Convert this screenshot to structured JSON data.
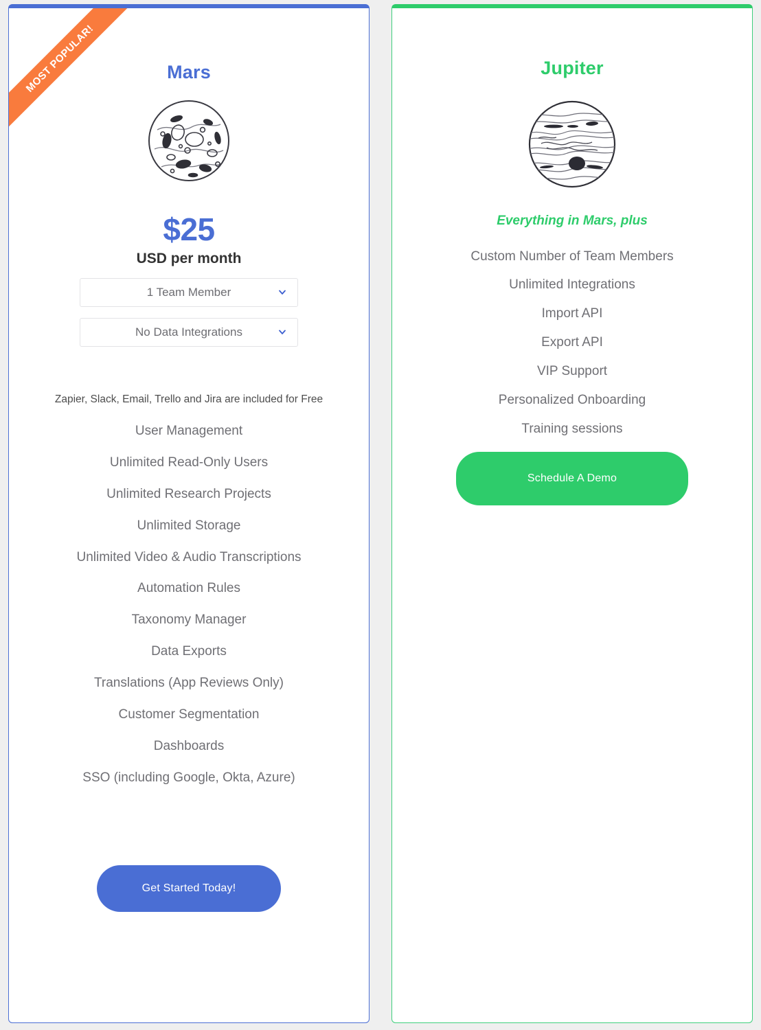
{
  "theme": {
    "page_background": "#efefef",
    "mars_accent": "#4a6ed4",
    "jupiter_accent": "#2ecc6b",
    "ribbon_color": "#f97b3d",
    "feature_text": "#6f6f74"
  },
  "plans": {
    "mars": {
      "ribbon_label": "MOST POPULAR!",
      "name": "Mars",
      "planet_icon": "mars-planet-icon",
      "price": "$25",
      "price_period": "USD per month",
      "selects": [
        {
          "value": "1 Team Member",
          "icon": "chevron-down-icon"
        },
        {
          "value": "No Data Integrations",
          "icon": "chevron-down-icon"
        }
      ],
      "included_note": "Zapier, Slack, Email, Trello and Jira are included for Free",
      "features": [
        "User Management",
        "Unlimited Read-Only Users",
        "Unlimited Research Projects",
        "Unlimited Storage",
        "Unlimited Video & Audio Transcriptions",
        "Automation Rules",
        "Taxonomy Manager",
        "Data Exports",
        "Translations (App Reviews Only)",
        "Customer Segmentation",
        "Dashboards",
        "SSO (including Google, Okta, Azure)"
      ],
      "cta_label": "Get Started Today!"
    },
    "jupiter": {
      "name": "Jupiter",
      "planet_icon": "jupiter-planet-icon",
      "tagline": "Everything in Mars, plus",
      "features": [
        "Custom Number of Team Members",
        "Unlimited Integrations",
        "Import API",
        "Export API",
        "VIP Support",
        "Personalized Onboarding",
        "Training sessions"
      ],
      "cta_label": "Schedule A Demo"
    }
  }
}
